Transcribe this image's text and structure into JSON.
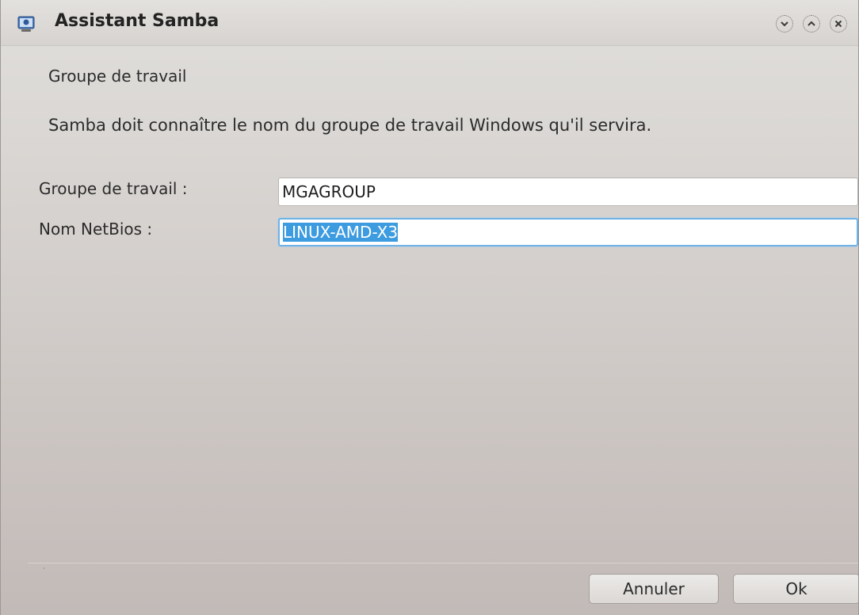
{
  "window": {
    "title": "Assistant Samba",
    "app_icon": "samba-wizard-icon",
    "controls": [
      "minimize-icon",
      "maximize-icon",
      "close-icon"
    ]
  },
  "page": {
    "section_title": "Groupe de travail",
    "description": "Samba doit connaître le nom du groupe de travail Windows qu'il servira."
  },
  "form": {
    "workgroup": {
      "label": "Groupe de travail :",
      "value": "MGAGROUP"
    },
    "netbios": {
      "label": "Nom NetBios :",
      "value": "LINUX-AMD-X3"
    }
  },
  "buttons": {
    "cancel": "Annuler",
    "ok": "Ok"
  },
  "colors": {
    "focus_border": "#6fb2e6",
    "selection": "#3d9be0"
  }
}
